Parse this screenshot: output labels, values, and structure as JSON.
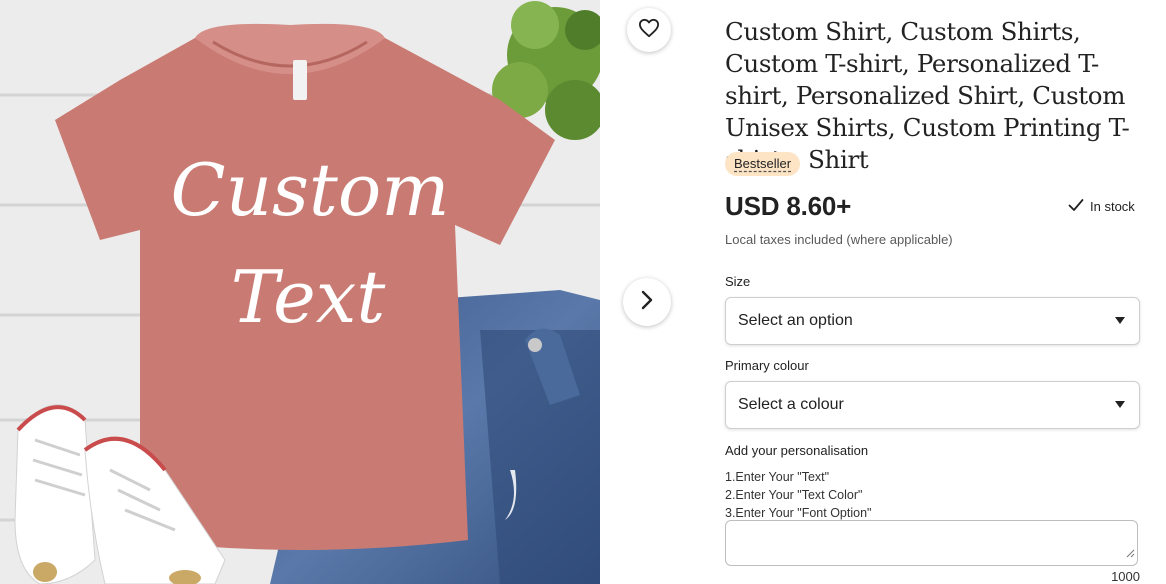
{
  "product": {
    "title": "Custom Shirt, Custom Shirts, Custom T-shirt, Personalized T-shirt, Personalized Shirt, Custom Unisex Shirts, Custom Printing T-shirts, Shirt",
    "badge": "Bestseller",
    "price": "USD 8.60+",
    "stock": "In stock",
    "tax_note": "Local taxes included (where applicable)"
  },
  "image": {
    "shirt_text_line1": "Custom",
    "shirt_text_line2": "Text",
    "shirt_color": "#c97b73",
    "background": "#ebebeb"
  },
  "buttons": {
    "favorite_icon": "heart-icon",
    "next_icon": "chevron-right-icon"
  },
  "size": {
    "label": "Size",
    "value": "Select an option"
  },
  "colour": {
    "label": "Primary colour",
    "value": "Select a colour"
  },
  "personalisation": {
    "label": "Add your personalisation",
    "lines": [
      "1.Enter Your \"Text\"",
      "2.Enter Your \"Text Color\"",
      "3.Enter Your \"Font Option\""
    ],
    "char_limit": "1000"
  },
  "colors": {
    "badge_bg": "#fce4c5",
    "text": "#222222"
  }
}
